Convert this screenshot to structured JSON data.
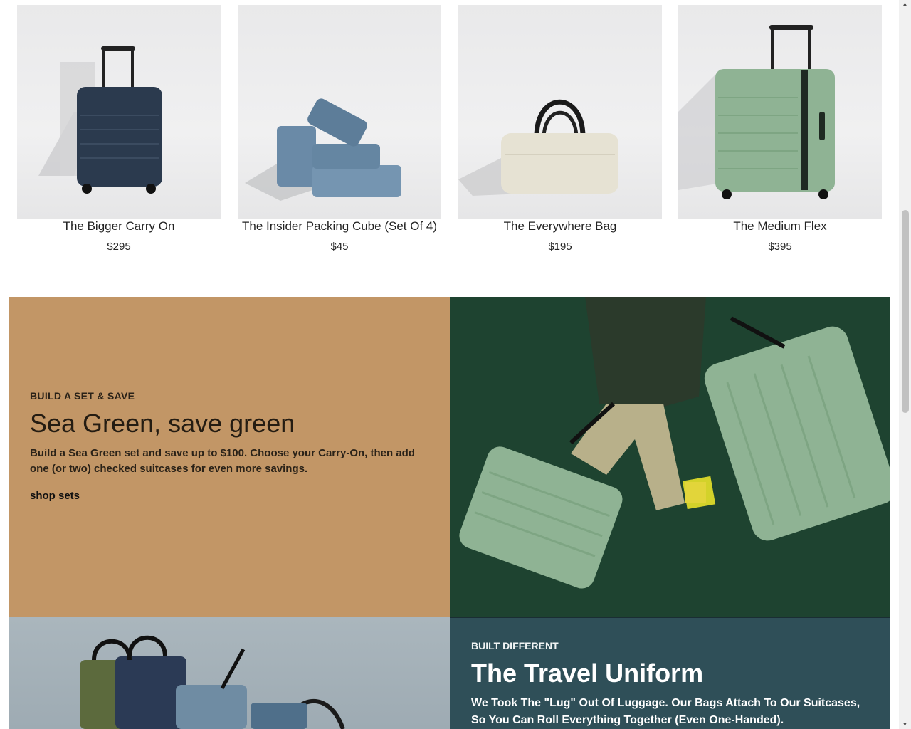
{
  "products": [
    {
      "name": "The Bigger Carry On",
      "price": "$295",
      "image_icon": "navy-carry-on-suitcase"
    },
    {
      "name": "The Insider Packing Cube (Set Of 4)",
      "price": "$45",
      "image_icon": "blue-packing-cubes"
    },
    {
      "name": "The Everywhere Bag",
      "price": "$195",
      "image_icon": "cream-duffel-bag"
    },
    {
      "name": "The Medium Flex",
      "price": "$395",
      "image_icon": "green-medium-suitcase"
    }
  ],
  "promo": {
    "eyebrow": "BUILD A SET & SAVE",
    "headline": "Sea Green, save green",
    "body": "Build a Sea Green set and save up to $100. Choose your Carry-On, then add one (or two) checked suitcases for even more savings.",
    "cta": "shop sets",
    "background": "#c29666",
    "image_icon": "person-pulling-green-suitcases"
  },
  "uniform": {
    "eyebrow": "BUILT DIFFERENT",
    "headline": "The Travel Uniform",
    "body": "We Took The \"Lug\" Out Of Luggage. Our Bags Attach To Our Suitcases, So You Can Roll Everything Together (Even One-Handed).",
    "background": "#2f4f58",
    "image_icon": "stacked-bags"
  },
  "colors": {
    "sea_green": "#8fb394",
    "navy": "#2b3a4e",
    "cube_blue": "#6a8aa7",
    "cream": "#e6e2d3"
  }
}
